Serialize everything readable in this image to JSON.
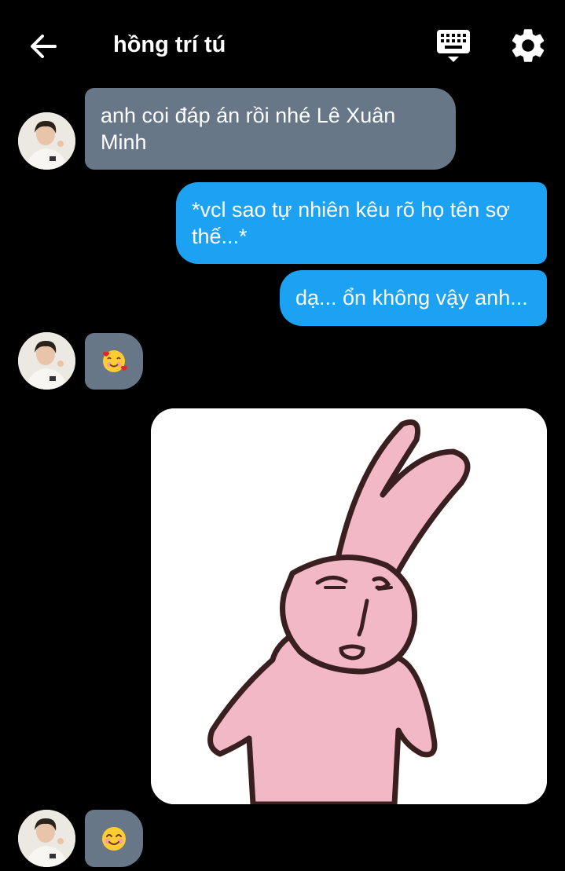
{
  "header": {
    "title": "hồng trí tú"
  },
  "messages": [
    {
      "direction": "received",
      "text": "anh coi đáp án rồi nhé Lê Xuân Minh"
    },
    {
      "direction": "sent",
      "text": "*vcl sao tự nhiên kêu rõ họ tên sợ thế...*"
    },
    {
      "direction": "sent",
      "text": "dạ... ổn không vậy anh..."
    },
    {
      "direction": "received",
      "emoji": "smiling-face-with-hearts"
    },
    {
      "direction": "sent",
      "sticker": "pink-rabbit-sticker"
    },
    {
      "direction": "received",
      "emoji": "smiling-face-with-smiling-eyes"
    }
  ],
  "colors": {
    "background": "#000000",
    "received_bubble": "#677787",
    "sent_bubble": "#1da1f2",
    "sticker_background": "#ffffff",
    "rabbit_pink": "#f2b8c6"
  }
}
